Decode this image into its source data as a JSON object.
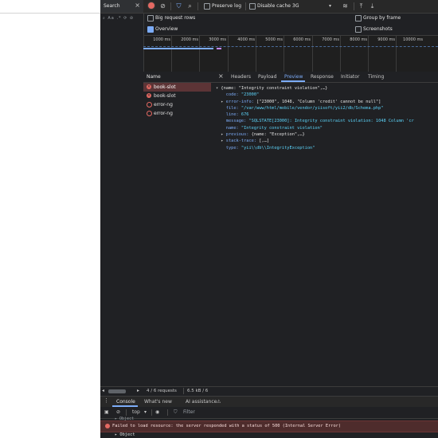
{
  "toolbar": {
    "search_tab": "Search",
    "preserve_log": "Preserve log",
    "disable_cache": "Disable cache",
    "throttling": "3G"
  },
  "options": {
    "big_request_rows": "Big request rows",
    "overview": "Overview",
    "group_by_frame": "Group by frame",
    "screenshots": "Screenshots"
  },
  "timeline": {
    "ticks": [
      "1000 ms",
      "2000 ms",
      "3000 ms",
      "4000 ms",
      "5000 ms",
      "6000 ms",
      "7000 ms",
      "8000 ms",
      "9000 ms",
      "10000 ms"
    ]
  },
  "requests": {
    "header": "Name",
    "items": [
      {
        "label": "book-slot",
        "icon": "error-icon",
        "selected": true
      },
      {
        "label": "book-slot",
        "icon": "error-icon",
        "selected": false
      },
      {
        "label": "error-ng",
        "icon": "xhr-icon",
        "selected": false
      },
      {
        "label": "error-ng",
        "icon": "xhr-icon",
        "selected": false
      }
    ]
  },
  "detail_tabs": [
    "Headers",
    "Payload",
    "Preview",
    "Response",
    "Initiator",
    "Timing"
  ],
  "detail_active": "Preview",
  "preview": {
    "root": "{name: \"Integrity constraint violation\",…}",
    "code_key": "code: ",
    "code_val": "\"23000\"",
    "errorinfo_key": "error-info: ",
    "errorinfo_val": "[\"23000\", 1048, \"Column 'credit' cannot be null\"]",
    "file_key": "file: ",
    "file_val": "\"/var/www/html/mobile/vendor/yiisoft/yii2/db/Schema.php\"",
    "line_key": "line: ",
    "line_val": "676",
    "message_key": "message: ",
    "message_val": "\"SQLSTATE[23000]: Integrity constraint violation: 1048 Column 'cr",
    "name_key": "name: ",
    "name_val": "\"Integrity constraint violation\"",
    "previous_key": "previous: ",
    "previous_val": "{name: \"Exception\",…}",
    "stack_key": "stack-trace: ",
    "stack_val": "[,…]",
    "type_key": "type: ",
    "type_val": "\"yii\\\\db\\\\IntegrityException\""
  },
  "status": {
    "requests": "4 / 6 requests",
    "transferred": "6.5 kB / 6"
  },
  "drawer": {
    "tabs": [
      "Console",
      "What's new",
      "AI assistance"
    ],
    "context": "top",
    "filter_placeholder": "Filter",
    "object_above": "Object",
    "error_message": "Failed to load resource: the server responded with a status of 500 (Internal Server Error)",
    "object_below": "Object"
  },
  "colors": {
    "accent": "#7cacf8",
    "error": "#e46962",
    "background": "#202124"
  }
}
